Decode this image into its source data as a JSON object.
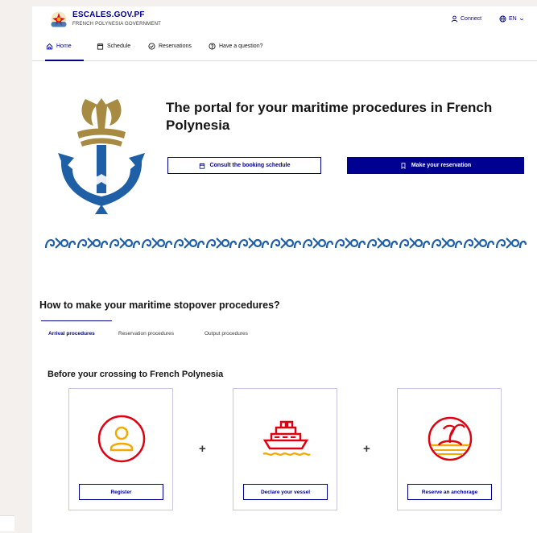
{
  "header": {
    "brand_name": "ESCALES.GOV.PF",
    "brand_sub": "FRENCH POLYNESIA GOVERNMENT",
    "connect_label": "Connect",
    "lang_label": "EN",
    "logo_icon": "tiare-flower-logo-icon"
  },
  "nav": {
    "items": [
      {
        "label": "Home",
        "icon": "home-icon",
        "active": true
      },
      {
        "label": "Schedule",
        "icon": "calendar-icon",
        "active": false
      },
      {
        "label": "Reservations",
        "icon": "check-circle-icon",
        "active": false
      },
      {
        "label": "Have a question?",
        "icon": "question-circle-icon",
        "active": false
      }
    ]
  },
  "hero": {
    "title": "The portal for your maritime procedures in French Polynesia",
    "consult_label": "Consult the booking schedule",
    "reserve_label": "Make your reservation"
  },
  "section": {
    "title": "How to make your maritime stopover procedures?",
    "tabs": [
      {
        "label": "Arrival procedures",
        "active": true
      },
      {
        "label": "Reservation procedures",
        "active": false
      },
      {
        "label": "Output procedures",
        "active": false
      }
    ],
    "subtitle": "Before your crossing to French Polynesia",
    "plus": "+",
    "cards": [
      {
        "label": "Register",
        "icon": "user-circle-icon"
      },
      {
        "label": "Declare your vessel",
        "icon": "cruise-ship-icon"
      },
      {
        "label": "Reserve an anchorage",
        "icon": "island-circle-icon"
      }
    ]
  },
  "colors": {
    "primary": "#000091",
    "accent_red": "#e1000f",
    "emblem_blue": "#1f5fa5",
    "emblem_gold": "#a78b43",
    "ship_yellow": "#f2a900"
  }
}
